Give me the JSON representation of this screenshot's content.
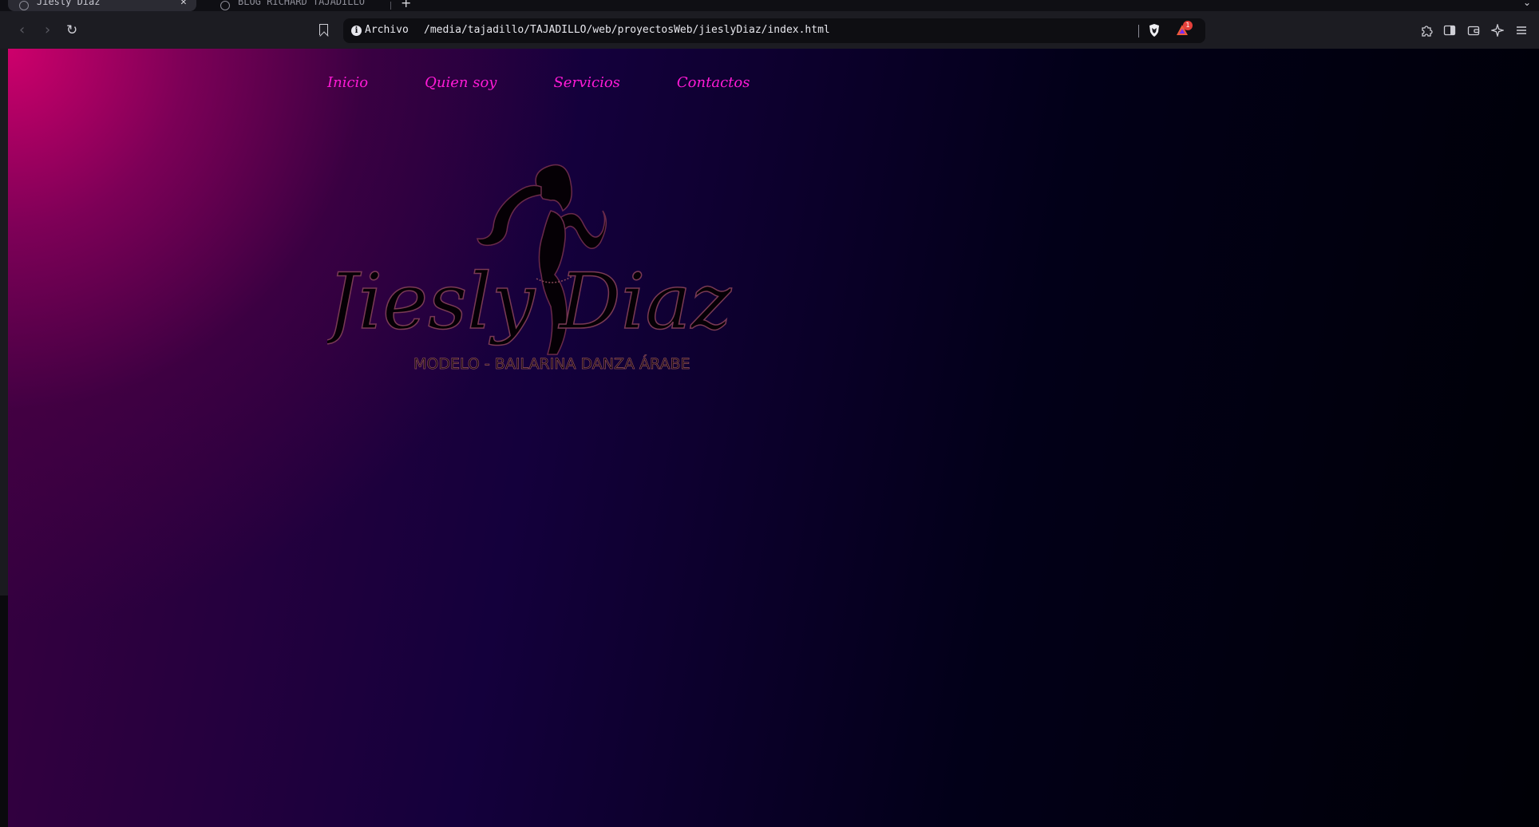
{
  "browser": {
    "tabs": [
      {
        "title": "Jiesly Diaz",
        "active": true
      },
      {
        "title": "BLOG RICHARD TAJADILLO",
        "active": false
      }
    ],
    "address": {
      "label": "Archivo",
      "url": "/media/tajadillo/TAJADILLO/web/proyectosWeb/jieslyDiaz/index.html"
    },
    "rewards_badge": "1"
  },
  "site": {
    "nav": [
      "Inicio",
      "Quien soy",
      "Servicios",
      "Contactos"
    ],
    "logo": {
      "name": "Jiesly Diaz",
      "tagline": "MODELO - BAILARINA DANZA ÁRABE"
    }
  },
  "colors": {
    "nav_link": "#ff1ad6",
    "gradient_start": "#d6006e",
    "gradient_end": "#000006"
  }
}
